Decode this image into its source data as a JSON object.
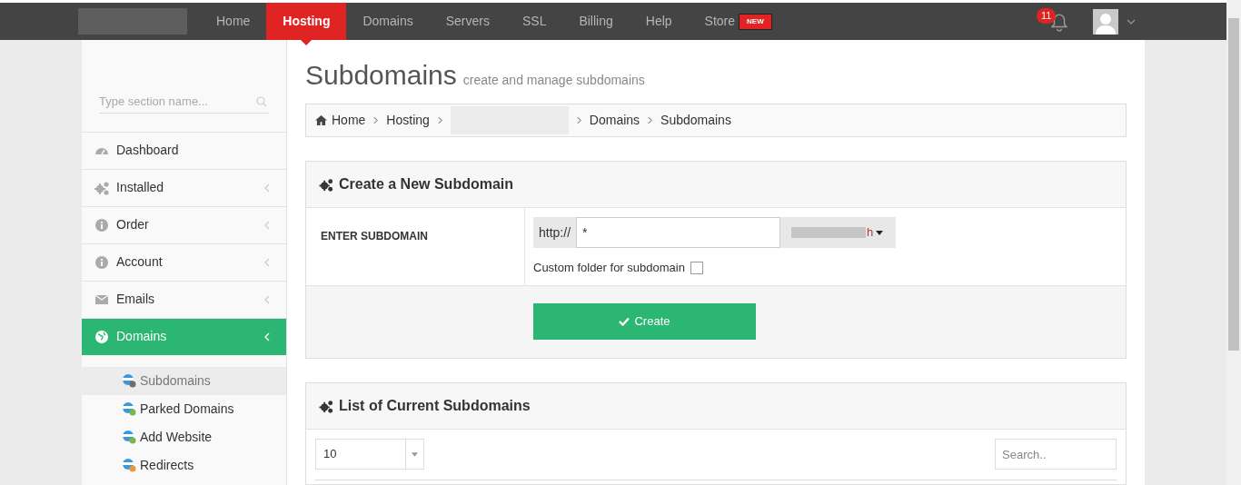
{
  "nav": {
    "items": [
      {
        "label": "Home",
        "selected": false
      },
      {
        "label": "Hosting",
        "selected": true
      },
      {
        "label": "Domains",
        "selected": false
      },
      {
        "label": "Servers",
        "selected": false
      },
      {
        "label": "SSL",
        "selected": false
      },
      {
        "label": "Billing",
        "selected": false
      },
      {
        "label": "Help",
        "selected": false
      },
      {
        "label": "Store",
        "selected": false,
        "badge": "NEW"
      }
    ],
    "notifications": "11"
  },
  "sidebar": {
    "search": {
      "placeholder": "Type section name..."
    },
    "items": [
      {
        "label": "Dashboard",
        "kind": "gauge",
        "expandable": false,
        "selected": false
      },
      {
        "label": "Installed",
        "kind": "gears",
        "expandable": true,
        "selected": false
      },
      {
        "label": "Order",
        "kind": "info",
        "expandable": true,
        "selected": false
      },
      {
        "label": "Account",
        "kind": "info",
        "expandable": true,
        "selected": false
      },
      {
        "label": "Emails",
        "kind": "mail",
        "expandable": true,
        "selected": false
      },
      {
        "label": "Domains",
        "kind": "globe",
        "expandable": true,
        "selected": true
      }
    ],
    "subitems": [
      {
        "label": "Subdomains",
        "color": "#6d6d6d",
        "selected": true
      },
      {
        "label": "Parked Domains",
        "color": "#7ab648",
        "selected": false
      },
      {
        "label": "Add Website",
        "color": "#7ab648",
        "selected": false
      },
      {
        "label": "Redirects",
        "color": "#f0953a",
        "selected": false
      }
    ]
  },
  "page": {
    "title": "Subdomains",
    "subtitle": "create and manage subdomains",
    "breadcrumb": [
      {
        "label": "Home",
        "kind": "home"
      },
      {
        "label": "Hosting",
        "kind": "text"
      },
      {
        "kind": "redacted"
      },
      {
        "label": "Domains",
        "kind": "text"
      },
      {
        "label": "Subdomains",
        "kind": "text"
      }
    ]
  },
  "create_panel": {
    "title": "Create a New Subdomain",
    "field_label": "ENTER SUBDOMAIN",
    "prefix": "http://",
    "value": "*",
    "domain_tail": "h",
    "custom_folder": {
      "label": "Custom folder for subdomain",
      "checked": false
    },
    "button": "Create"
  },
  "list_panel": {
    "title": "List of Current Subdomains",
    "page_size": "10",
    "search": {
      "placeholder": "Search.."
    }
  }
}
